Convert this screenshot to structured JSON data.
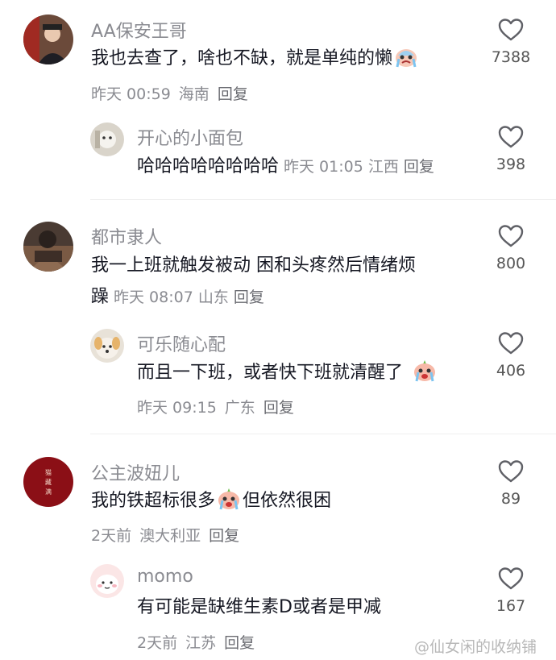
{
  "comments": [
    {
      "user": "AA保安王哥",
      "text": "我也去查了，啥也不缺，就是单纯的懒",
      "emoji": "crying-face-emoji",
      "time": "昨天 00:59",
      "location": "海南",
      "reply": "回复",
      "likes": "7388",
      "reply_comment": {
        "user": "开心的小面包",
        "text": "哈哈哈哈哈哈哈哈",
        "time": "昨天 01:05",
        "location": "江西",
        "reply": "回复",
        "likes": "398"
      }
    },
    {
      "user": "都市隶人",
      "text_line1": "我一上班就触发被动 困和头疼然后情绪烦",
      "text_line2": "躁",
      "time": "昨天 08:07",
      "location": "山东",
      "reply": "回复",
      "likes": "800",
      "reply_comment": {
        "user": "可乐随心配",
        "text": "而且一下班，或者快下班就清醒了",
        "emoji": "crying-face-emoji",
        "time": "昨天 09:15",
        "location": "广东",
        "reply": "回复",
        "likes": "406"
      }
    },
    {
      "user": "公主波妞儿",
      "text_a": "我的铁超标很多",
      "text_b": "但依然很困",
      "emoji": "crying-face-emoji",
      "time": "2天前",
      "location": "澳大利亚",
      "reply": "回复",
      "likes": "89",
      "reply_comment": {
        "user": "momo",
        "text": "有可能是缺维生素D或者是甲减",
        "time": "2天前",
        "location": "江苏",
        "reply": "回复",
        "likes": "167"
      }
    }
  ],
  "watermark": "@仙女闲的收纳铺",
  "colors": {
    "text": "#161823",
    "secondary": "#8a8b91",
    "divider": "#efefef"
  }
}
